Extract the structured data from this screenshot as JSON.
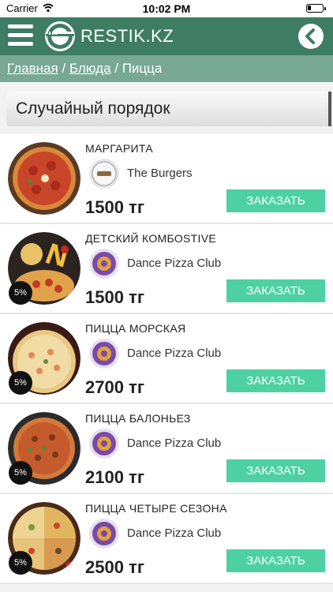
{
  "status_bar": {
    "carrier": "Carrier",
    "time": "10:02 PM"
  },
  "header": {
    "brand": "RESTIK.KZ",
    "accent_color": "#3e7c63"
  },
  "breadcrumb": {
    "home": "Главная",
    "sep1": " / ",
    "dishes": "Блюда",
    "sep2": " / ",
    "current": "Пицца"
  },
  "sort": {
    "label": "Случайный порядок"
  },
  "order_color": "#4dd1a3",
  "items": [
    {
      "name": "МАРГАРИТА",
      "restaurant": "The Burgers",
      "price": "1500 тг",
      "order_label": "ЗАКАЗАТЬ",
      "discount": ""
    },
    {
      "name": "ДЕТСКИЙ КОМБОSTIVE",
      "restaurant": "Dance Pizza Club",
      "price": "1500 тг",
      "order_label": "ЗАКАЗАТЬ",
      "discount": "5%"
    },
    {
      "name": "ПИЦЦА МОРСКАЯ",
      "restaurant": "Dance Pizza Club",
      "price": "2700 тг",
      "order_label": "ЗАКАЗАТЬ",
      "discount": "5%"
    },
    {
      "name": "ПИЦЦА БАЛОНЬЕЗ",
      "restaurant": "Dance Pizza Club",
      "price": "2100 тг",
      "order_label": "ЗАКАЗАТЬ",
      "discount": "5%"
    },
    {
      "name": "ПИЦЦА ЧЕТЫРЕ СЕЗОНА",
      "restaurant": "Dance Pizza Club",
      "price": "2500 тг",
      "order_label": "ЗАКАЗАТЬ",
      "discount": "5%"
    }
  ]
}
